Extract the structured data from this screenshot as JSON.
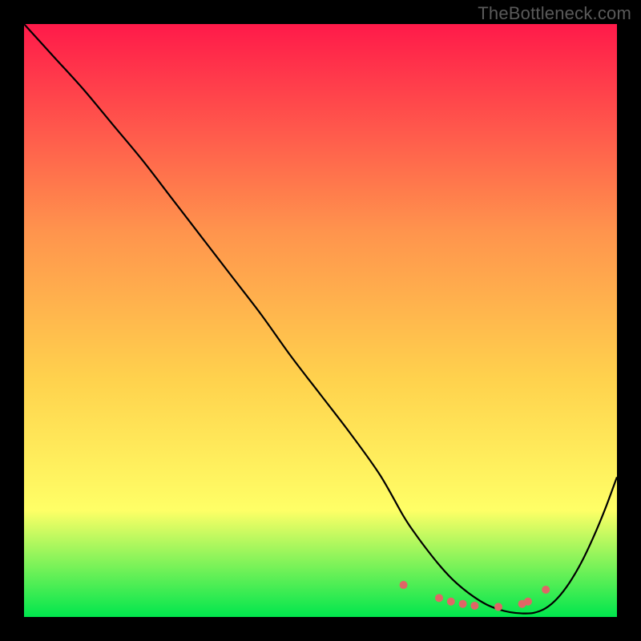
{
  "watermark": "TheBottleneck.com",
  "chart_data": {
    "type": "line",
    "title": "",
    "xlabel": "",
    "ylabel": "",
    "xlim": [
      0,
      100
    ],
    "ylim": [
      0,
      100
    ],
    "grid": false,
    "legend": false,
    "background_gradient": {
      "top": "#ff1a4a",
      "mid1": "#ff944d",
      "mid2": "#ffd24d",
      "mid3": "#ffff66",
      "bottom": "#00e64d"
    },
    "x": [
      0,
      5,
      10,
      15,
      20,
      25,
      30,
      35,
      40,
      45,
      50,
      55,
      60,
      64,
      66,
      68,
      70,
      72,
      74,
      76,
      78,
      80,
      82,
      84,
      86,
      88,
      90,
      92,
      94,
      96,
      98,
      100
    ],
    "y": [
      100,
      94.5,
      89,
      83,
      77,
      70.5,
      64,
      57.5,
      51,
      44,
      37.5,
      31,
      24,
      17,
      14,
      11.3,
      8.8,
      6.6,
      4.8,
      3.3,
      2.1,
      1.3,
      0.8,
      0.6,
      0.7,
      1.5,
      3.2,
      5.8,
      9.2,
      13.4,
      18.2,
      23.6
    ],
    "highlight_points_x": [
      64,
      70,
      72,
      74,
      76,
      80,
      84,
      85,
      88
    ],
    "highlight_points_y": [
      5.4,
      3.2,
      2.6,
      2.2,
      1.9,
      1.7,
      2.2,
      2.6,
      4.6
    ],
    "curve_color": "#000000",
    "highlight_color": "#e06666",
    "highlight_radius": 5
  }
}
